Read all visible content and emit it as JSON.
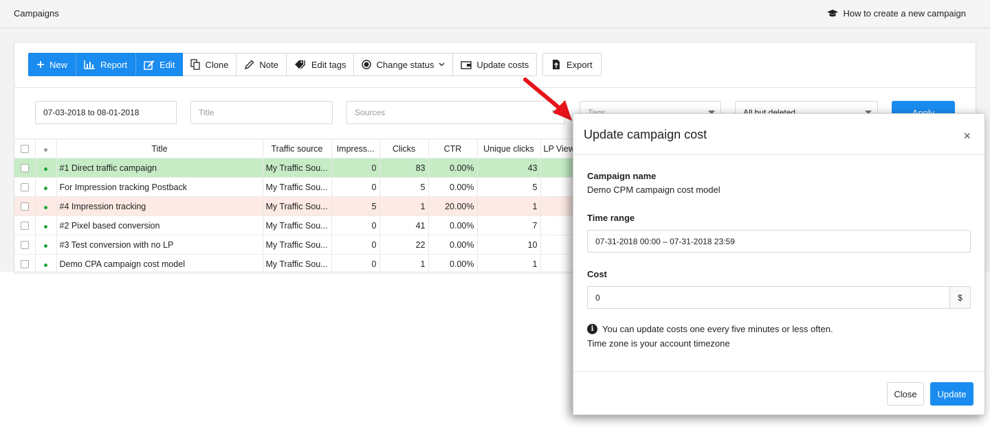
{
  "header": {
    "title": "Campaigns",
    "help_link": "How to create a new campaign"
  },
  "toolbar": {
    "new": "New",
    "report": "Report",
    "edit": "Edit",
    "clone": "Clone",
    "note": "Note",
    "edit_tags": "Edit tags",
    "change_status": "Change status",
    "update_costs": "Update costs",
    "export": "Export"
  },
  "filters": {
    "date_range": "07-03-2018 to 08-01-2018",
    "title_placeholder": "Title",
    "sources_placeholder": "Sources",
    "tags_placeholder": "Tags",
    "status": "All but deleted",
    "apply": "Apply"
  },
  "table": {
    "columns": [
      "Title",
      "Traffic source",
      "Impress...",
      "Clicks",
      "CTR",
      "Unique clicks",
      "LP View"
    ],
    "rows": [
      {
        "title": "#1 Direct traffic campaign",
        "source": "My Traffic Sou...",
        "impressions": "0",
        "clicks": "83",
        "ctr": "0.00%",
        "unique": "43",
        "highlight": "green"
      },
      {
        "title": "For Impression tracking Postback",
        "source": "My Traffic Sou...",
        "impressions": "0",
        "clicks": "5",
        "ctr": "0.00%",
        "unique": "5",
        "highlight": ""
      },
      {
        "title": "#4 Impression tracking",
        "source": "My Traffic Sou...",
        "impressions": "5",
        "clicks": "1",
        "ctr": "20.00%",
        "unique": "1",
        "highlight": "pink"
      },
      {
        "title": "#2 Pixel based conversion",
        "source": "My Traffic Sou...",
        "impressions": "0",
        "clicks": "41",
        "ctr": "0.00%",
        "unique": "7",
        "highlight": ""
      },
      {
        "title": "#3 Test conversion with no LP",
        "source": "My Traffic Sou...",
        "impressions": "0",
        "clicks": "22",
        "ctr": "0.00%",
        "unique": "10",
        "highlight": ""
      },
      {
        "title": "Demo CPA campaign cost model",
        "source": "My Traffic Sou...",
        "impressions": "0",
        "clicks": "1",
        "ctr": "0.00%",
        "unique": "1",
        "highlight": ""
      }
    ]
  },
  "modal": {
    "title": "Update campaign cost",
    "close_x": "×",
    "campaign_name_label": "Campaign name",
    "campaign_name": "Demo CPM campaign cost model",
    "time_range_label": "Time range",
    "time_range": "07-31-2018 00:00 – 07-31-2018 23:59",
    "cost_label": "Cost",
    "cost_value": "0",
    "currency": "$",
    "info_line1": "You can update costs one every five minutes or less often.",
    "info_line2": "Time zone is your account timezone",
    "close_button": "Close",
    "update_button": "Update"
  },
  "colors": {
    "accent": "#1a8cf0",
    "row_green": "#c6ecc6",
    "row_pink": "#fdeae4",
    "status_active": "#1fa537"
  }
}
